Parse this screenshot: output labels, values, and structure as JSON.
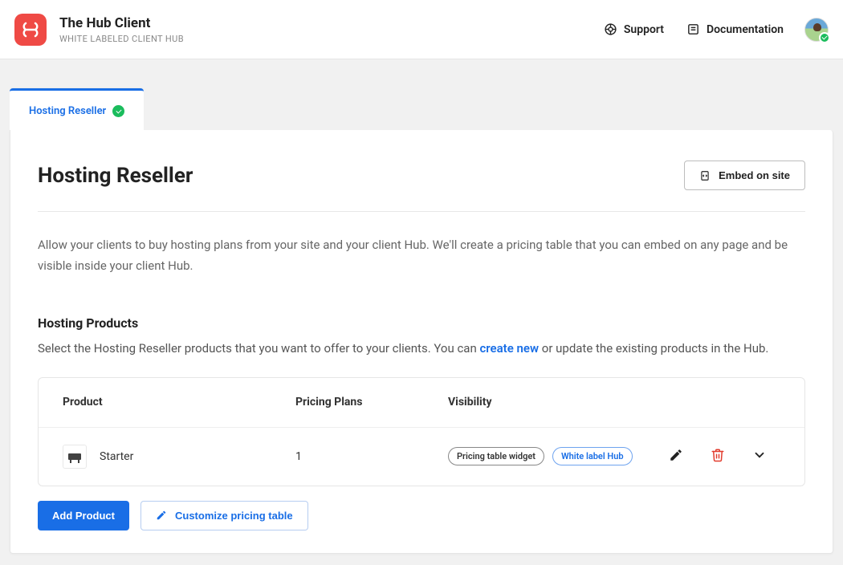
{
  "header": {
    "title": "The Hub Client",
    "subtitle": "WHITE LABELED CLIENT HUB",
    "support_label": "Support",
    "documentation_label": "Documentation"
  },
  "tab": {
    "label": "Hosting Reseller"
  },
  "panel": {
    "title": "Hosting Reseller",
    "embed_button": "Embed on site",
    "intro": "Allow your clients to buy hosting plans from your site and your client Hub. We'll create a pricing table that you can embed on any page and be visible inside your client Hub."
  },
  "products": {
    "section_title": "Hosting Products",
    "desc_before": "Select the Hosting Reseller products that you want to offer to your clients. You can ",
    "create_new_link": "create new",
    "desc_after": " or update the existing products in the Hub.",
    "columns": {
      "product": "Product",
      "pricing_plans": "Pricing Plans",
      "visibility": "Visibility"
    },
    "rows": [
      {
        "name": "Starter",
        "plans": "1",
        "visibility_pills": [
          "Pricing table widget",
          "White label Hub"
        ]
      }
    ]
  },
  "buttons": {
    "add_product": "Add Product",
    "customize": "Customize pricing table"
  }
}
